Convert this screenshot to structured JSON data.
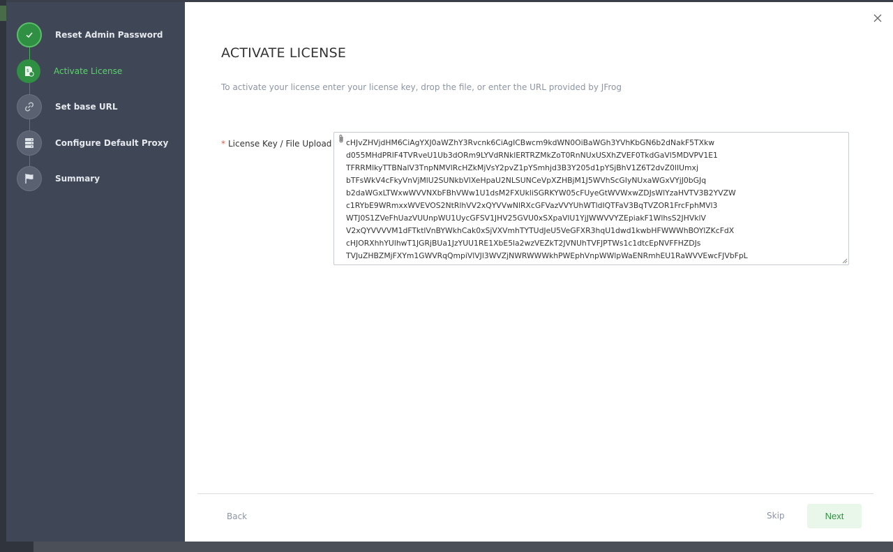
{
  "colors": {
    "sidebar_bg": "#3f4757",
    "accent_green": "#2f8f42",
    "active_label": "#5bd26a",
    "required_star": "#e05a4e",
    "next_bg": "#e9f7ea"
  },
  "wizard": {
    "steps": [
      {
        "label": "Reset Admin Password",
        "state": "done",
        "icon": "check-icon"
      },
      {
        "label": "Activate License",
        "state": "active",
        "icon": "license-icon"
      },
      {
        "label": "Set base URL",
        "state": "pending",
        "icon": "link-icon"
      },
      {
        "label": "Configure Default Proxy",
        "state": "pending",
        "icon": "server-icon"
      },
      {
        "label": "Summary",
        "state": "pending",
        "icon": "flag-icon"
      }
    ]
  },
  "main": {
    "title": "ACTIVATE LICENSE",
    "subtitle": "To activate your license enter your license key, drop the file, or enter the URL provided by JFrog",
    "field": {
      "required_mark": "*",
      "label": "License Key / File Upload",
      "value": "cHJvZHVjdHM6CiAgYXJ0aWZhY3Rvcnk6CiAgICBwcm9kdWN0OiBaWGh3YVhKbGN6b2dNakF5TXkw\nd055MHdPRlF4TVRveU1Ub3dORm9LYVdRNklERTRZMkZoT0RnNUxUSXhZVEF0TkdGaVl5MDVPV1E1\nTFRRMlkyTTBNalV3TnpNMVlRcHZkMjVsY2pvZ1pYSmhjd3B3Y205d1pYSjBhV1Z6T2dvZ0lIUmxj\nbTFsWkV4cFkyVnVjMlU2SUNkbVlXeHpaU2NLSUNCeVpXZHBjM1J5WVhScGIyNUxaWGxVYjJ0bGJq\nb2daWGxLTWxwWVVNXbFBhVWw1U1dsM2FXUkliSGRKYW05cFUyeGtWVWxwZDJsWlYzaHVTV3B2YVZW\nc1RYbE9WRmxxWVEVOS2NtRlhVV2xQYVVwNlRXcGFVazVVYUhWTldIQTFaV3BqTVZOR1FrcFphMVl3\nWTJ0S1ZVeFhUazVUUnpWU1UycGFSV1JHV25GVU0xSXpaVlU1YjJWWVVYZEpiakF1WlhsS2JHVklV\nV2xQYVVVVM1dFTktlVnBYWkhCak0xSjVXVmhTYTUdJeU5VeGFXR3hqU1dwd1kwbHFWWWhBOYlZKcFdX\ncHJORXhhYUlhwT1JGRjBUa1JzYUU1RE1XbE5la2wzVEZkT2JVNUhTVFJPTWs1c1dtcEpNVFFHZDJs\nTVJuZHBZMjFXYm1GWVRqQmpiVlVJl3WVZjNWRWWWkhPWEphVnpWWlpWaENRmhEU1RaWVVEwcFJVbFpL"
    }
  },
  "footer": {
    "back_label": "Back",
    "skip_label": "Skip",
    "next_label": "Next"
  }
}
